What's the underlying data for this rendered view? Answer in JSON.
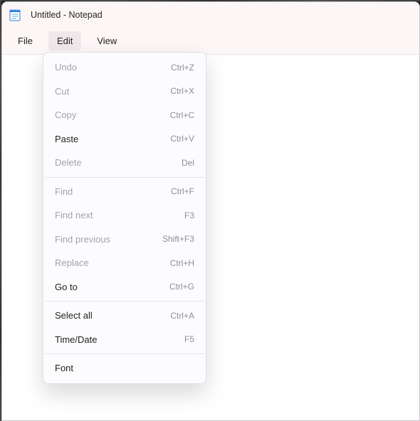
{
  "window": {
    "title": "Untitled - Notepad"
  },
  "menubar": {
    "items": [
      {
        "label": "File",
        "active": false
      },
      {
        "label": "Edit",
        "active": true
      },
      {
        "label": "View",
        "active": false
      }
    ]
  },
  "edit_menu": {
    "groups": [
      [
        {
          "label": "Undo",
          "shortcut": "Ctrl+Z",
          "enabled": false
        },
        {
          "label": "Cut",
          "shortcut": "Ctrl+X",
          "enabled": false
        },
        {
          "label": "Copy",
          "shortcut": "Ctrl+C",
          "enabled": false
        },
        {
          "label": "Paste",
          "shortcut": "Ctrl+V",
          "enabled": true
        },
        {
          "label": "Delete",
          "shortcut": "Del",
          "enabled": false
        }
      ],
      [
        {
          "label": "Find",
          "shortcut": "Ctrl+F",
          "enabled": false
        },
        {
          "label": "Find next",
          "shortcut": "F3",
          "enabled": false
        },
        {
          "label": "Find previous",
          "shortcut": "Shift+F3",
          "enabled": false
        },
        {
          "label": "Replace",
          "shortcut": "Ctrl+H",
          "enabled": false
        },
        {
          "label": "Go to",
          "shortcut": "Ctrl+G",
          "enabled": true
        }
      ],
      [
        {
          "label": "Select all",
          "shortcut": "Ctrl+A",
          "enabled": true
        },
        {
          "label": "Time/Date",
          "shortcut": "F5",
          "enabled": true
        }
      ],
      [
        {
          "label": "Font",
          "shortcut": "",
          "enabled": true
        }
      ]
    ]
  }
}
